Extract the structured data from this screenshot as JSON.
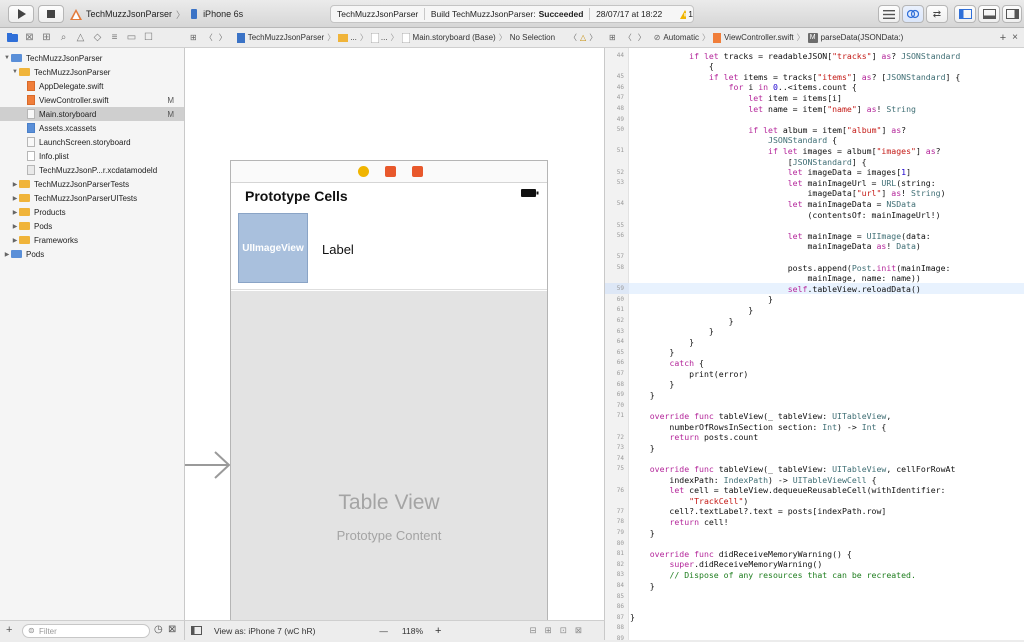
{
  "toolbar": {
    "scheme_name": "TechMuzzJsonParser",
    "device": "iPhone 6s",
    "status_project": "TechMuzzJsonParser",
    "status_prefix": "Build TechMuzzJsonParser:",
    "status_result": "Succeeded",
    "status_time": "28/07/17 at 18:22",
    "warning_count": "1"
  },
  "navigator": {
    "items": [
      {
        "label": "TechMuzzJsonParser",
        "type": "project",
        "disclosure": "▼",
        "indent": 0,
        "badge": ""
      },
      {
        "label": "TechMuzzJsonParser",
        "type": "folder",
        "disclosure": "▼",
        "indent": 1,
        "badge": ""
      },
      {
        "label": "AppDelegate.swift",
        "type": "swift",
        "disclosure": "",
        "indent": 2,
        "badge": ""
      },
      {
        "label": "ViewController.swift",
        "type": "swift",
        "disclosure": "",
        "indent": 2,
        "badge": "M"
      },
      {
        "label": "Main.storyboard",
        "type": "sb",
        "disclosure": "",
        "indent": 2,
        "badge": "M",
        "selected": true
      },
      {
        "label": "Assets.xcassets",
        "type": "assets",
        "disclosure": "",
        "indent": 2,
        "badge": ""
      },
      {
        "label": "LaunchScreen.storyboard",
        "type": "sb",
        "disclosure": "",
        "indent": 2,
        "badge": ""
      },
      {
        "label": "Info.plist",
        "type": "plain",
        "disclosure": "",
        "indent": 2,
        "badge": ""
      },
      {
        "label": "TechMuzzJsonP...r.xcdatamodeld",
        "type": "cd",
        "disclosure": "",
        "indent": 2,
        "badge": ""
      },
      {
        "label": "TechMuzzJsonParserTests",
        "type": "folder",
        "disclosure": "▶",
        "indent": 1,
        "badge": ""
      },
      {
        "label": "TechMuzzJsonParserUITests",
        "type": "folder",
        "disclosure": "▶",
        "indent": 1,
        "badge": ""
      },
      {
        "label": "Products",
        "type": "folder",
        "disclosure": "▶",
        "indent": 1,
        "badge": ""
      },
      {
        "label": "Pods",
        "type": "folder",
        "disclosure": "▶",
        "indent": 1,
        "badge": ""
      },
      {
        "label": "Frameworks",
        "type": "folder",
        "disclosure": "▶",
        "indent": 1,
        "badge": ""
      },
      {
        "label": "Pods",
        "type": "project",
        "disclosure": "▶",
        "indent": 0,
        "badge": ""
      }
    ],
    "filter_placeholder": "Filter"
  },
  "ib_jumpbar": {
    "project": "TechMuzzJsonParser",
    "folder": "...",
    "group": "...",
    "file": "Main.storyboard (Base)",
    "selection": "No Selection"
  },
  "canvas": {
    "nav_title": "Prototype Cells",
    "image_view_label": "UIImageView",
    "cell_label": "Label",
    "table_title": "Table View",
    "table_subtitle": "Prototype Content"
  },
  "ib_bottom": {
    "view_as": "View as: iPhone 7 (wC hR)",
    "zoom_minus": "—",
    "zoom": "118%",
    "zoom_plus": "+"
  },
  "editor_jumpbar": {
    "mode": "Automatic",
    "file": "ViewController.swift",
    "symbol_badge": "M",
    "method": "parseData(JSONData:)"
  },
  "code_lines": [
    {
      "n": "44",
      "t": "            if let tracks = readableJSON[\"tracks\"] as? JSONStandard"
    },
    {
      "n": "",
      "t": "                {"
    },
    {
      "n": "45",
      "t": "                if let items = tracks[\"items\"] as? [JSONStandard] {"
    },
    {
      "n": "46",
      "t": "                    for i in 0..<items.count {"
    },
    {
      "n": "47",
      "t": "                        let item = items[i]"
    },
    {
      "n": "48",
      "t": "                        let name = item[\"name\"] as! String"
    },
    {
      "n": "49",
      "t": ""
    },
    {
      "n": "50",
      "t": "                        if let album = item[\"album\"] as?"
    },
    {
      "n": "",
      "t": "                            JSONStandard {"
    },
    {
      "n": "51",
      "t": "                            if let images = album[\"images\"] as?"
    },
    {
      "n": "",
      "t": "                                [JSONStandard] {"
    },
    {
      "n": "52",
      "t": "                                let imageData = images[1]"
    },
    {
      "n": "53",
      "t": "                                let mainImageUrl = URL(string:"
    },
    {
      "n": "",
      "t": "                                    imageData[\"url\"] as! String)"
    },
    {
      "n": "54",
      "t": "                                let mainImageData = NSData"
    },
    {
      "n": "",
      "t": "                                    (contentsOf: mainImageUrl!)"
    },
    {
      "n": "55",
      "t": ""
    },
    {
      "n": "56",
      "t": "                                let mainImage = UIImage(data:"
    },
    {
      "n": "",
      "t": "                                    mainImageData as! Data)"
    },
    {
      "n": "57",
      "t": ""
    },
    {
      "n": "58",
      "t": "                                posts.append(Post.init(mainImage:"
    },
    {
      "n": "",
      "t": "                                    mainImage, name: name))"
    },
    {
      "n": "59",
      "t": "                                self.tableView.reloadData()",
      "current": true
    },
    {
      "n": "60",
      "t": "                            }"
    },
    {
      "n": "61",
      "t": "                        }"
    },
    {
      "n": "62",
      "t": "                    }"
    },
    {
      "n": "63",
      "t": "                }"
    },
    {
      "n": "64",
      "t": "            }"
    },
    {
      "n": "65",
      "t": "        }"
    },
    {
      "n": "66",
      "t": "        catch {"
    },
    {
      "n": "67",
      "t": "            print(error)"
    },
    {
      "n": "68",
      "t": "        }"
    },
    {
      "n": "69",
      "t": "    }"
    },
    {
      "n": "70",
      "t": ""
    },
    {
      "n": "71",
      "t": "    override func tableView(_ tableView: UITableView,"
    },
    {
      "n": "",
      "t": "        numberOfRowsInSection section: Int) -> Int {"
    },
    {
      "n": "72",
      "t": "        return posts.count"
    },
    {
      "n": "73",
      "t": "    }"
    },
    {
      "n": "74",
      "t": ""
    },
    {
      "n": "75",
      "t": "    override func tableView(_ tableView: UITableView, cellForRowAt"
    },
    {
      "n": "",
      "t": "        indexPath: IndexPath) -> UITableViewCell {"
    },
    {
      "n": "76",
      "t": "        let cell = tableView.dequeueReusableCell(withIdentifier:"
    },
    {
      "n": "",
      "t": "            \"TrackCell\")"
    },
    {
      "n": "77",
      "t": "        cell?.textLabel?.text = posts[indexPath.row]"
    },
    {
      "n": "78",
      "t": "        return cell!"
    },
    {
      "n": "79",
      "t": "    }"
    },
    {
      "n": "80",
      "t": ""
    },
    {
      "n": "81",
      "t": "    override func didReceiveMemoryWarning() {"
    },
    {
      "n": "82",
      "t": "        super.didReceiveMemoryWarning()"
    },
    {
      "n": "83",
      "t": "        // Dispose of any resources that can be recreated."
    },
    {
      "n": "84",
      "t": "    }"
    },
    {
      "n": "85",
      "t": ""
    },
    {
      "n": "86",
      "t": ""
    },
    {
      "n": "87",
      "t": "}"
    },
    {
      "n": "88",
      "t": ""
    },
    {
      "n": "89",
      "t": ""
    }
  ],
  "colors": {
    "keyword": "#b4269a",
    "string": "#c41a16",
    "type": "#3f6e74",
    "comment": "#1f7e1f",
    "image_view_fill": "#a9c0dd",
    "selection": "#cfcfcf",
    "current_line": "#e8f2fe"
  }
}
